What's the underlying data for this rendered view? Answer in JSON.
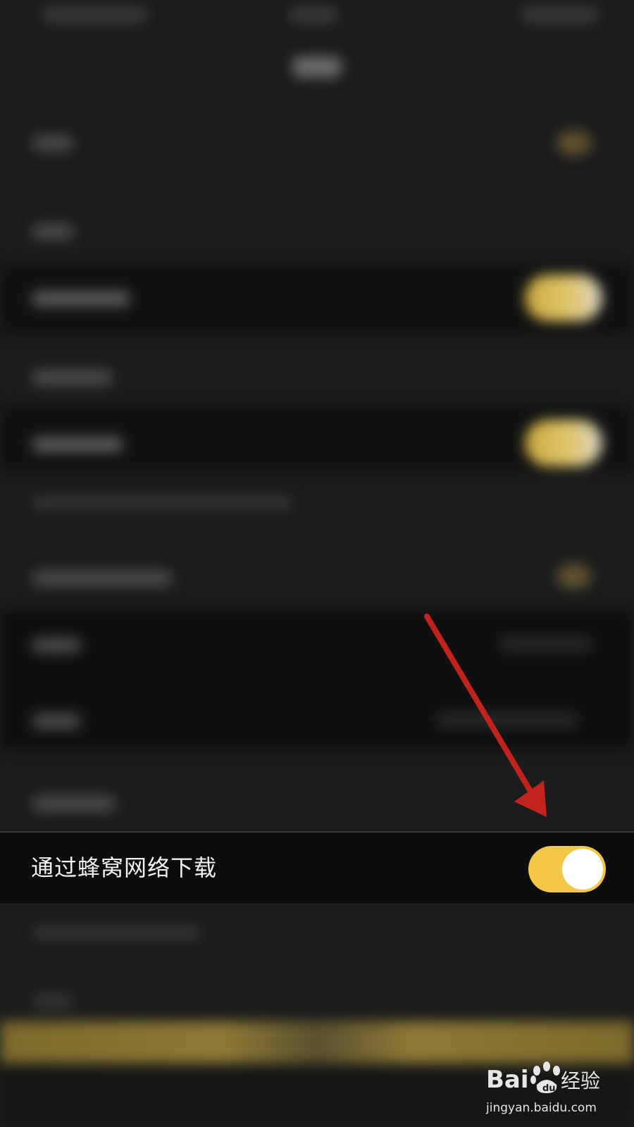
{
  "setting_row": {
    "label": "通过蜂窝网络下载",
    "toggle_state": "on"
  },
  "colors": {
    "background": "#1c1c1c",
    "row_background": "#0d0d0d",
    "toggle_on": "#f3c846",
    "knob": "#ffffff",
    "arrow": "#c0241c"
  },
  "watermark": {
    "brand": "Baidu经验",
    "url": "jingyan.baidu.com"
  }
}
